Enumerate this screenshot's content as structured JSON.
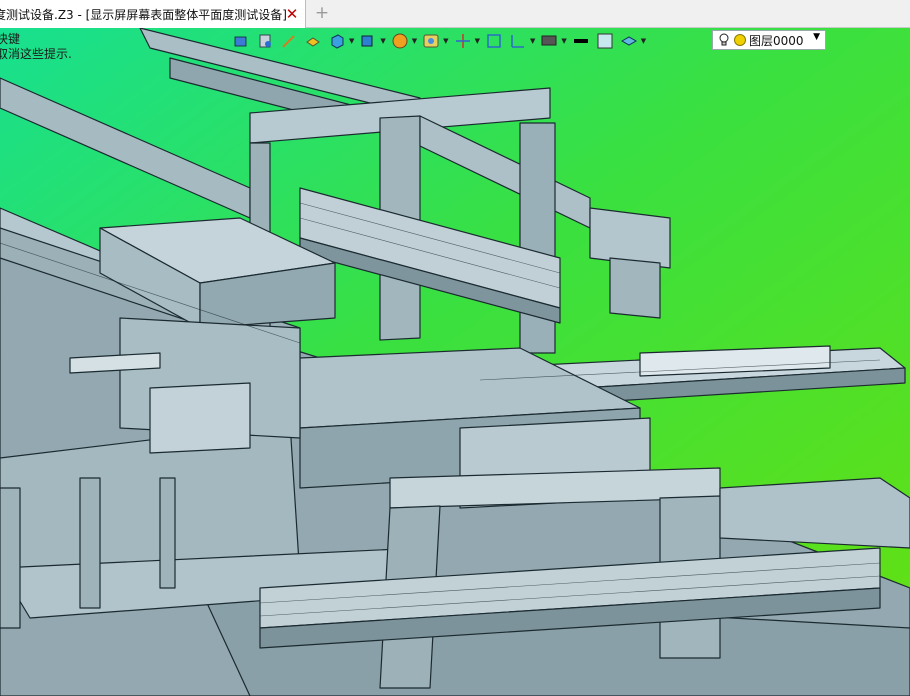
{
  "tab": {
    "title": "度测试设备.Z3 - [显示屏屏幕表面整体平面度测试设备]",
    "close_symbol": "✕",
    "add_symbol": "+"
  },
  "hint": {
    "line1": "快键",
    "line2": "取消这些提示."
  },
  "toolbar": {
    "icons": [
      "select-icon",
      "filter-icon",
      "sketch-icon",
      "extrude-icon",
      "solid-icon",
      "part-icon",
      "render-icon",
      "view-icon",
      "axis-icon",
      "frame-icon",
      "dimension-icon",
      "display-icon",
      "line-color-icon",
      "face-color-icon",
      "layer-plane-icon"
    ]
  },
  "layer": {
    "name": "图层0000",
    "arrow": "▼"
  },
  "colors": {
    "background_top": "#2ae07a",
    "background_mid": "#44e028",
    "machine_fill": "#9fb4bd",
    "machine_edge": "#1b2a30"
  }
}
